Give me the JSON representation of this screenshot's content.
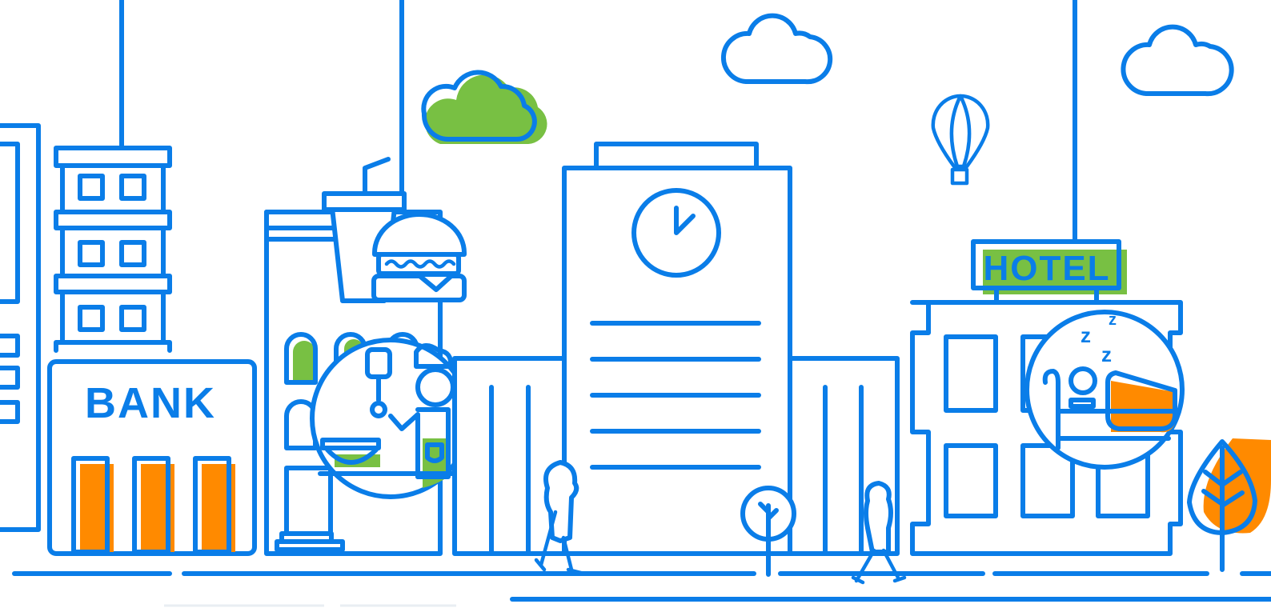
{
  "scene": {
    "bank_sign": "BANK",
    "hotel_sign": "HOTEL",
    "sleep_letters": [
      "z",
      "z",
      "z"
    ]
  },
  "colors": {
    "line": "#0a7de8",
    "green_accent": "#78c043",
    "orange_accent": "#ff8a00",
    "background": "#ffffff"
  },
  "icons": [
    "clock-icon",
    "burger-icon",
    "chef-icon",
    "sleeping-person-icon",
    "hot-air-balloon-icon",
    "cloud-icon",
    "tree-icon"
  ]
}
